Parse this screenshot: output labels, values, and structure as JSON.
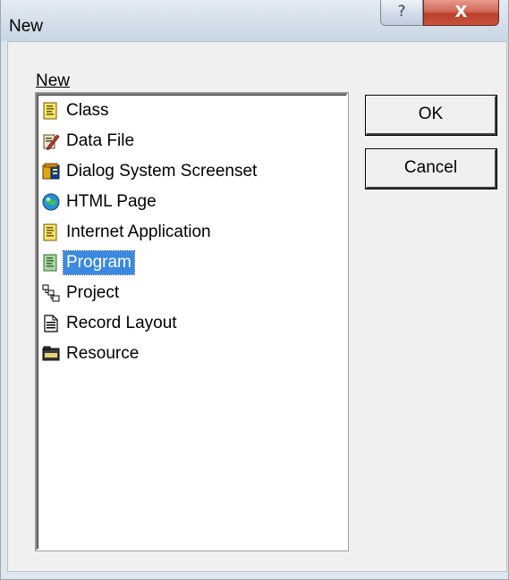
{
  "window": {
    "title": "New",
    "help_glyph": "?",
    "close_glyph": "X"
  },
  "dialog": {
    "list_label": "New",
    "ok_label": "OK",
    "cancel_label": "Cancel",
    "selected_item": "Program"
  },
  "list": {
    "items": [
      {
        "label": "Class",
        "icon": "class-document-icon"
      },
      {
        "label": "Data File",
        "icon": "data-file-pencil-icon"
      },
      {
        "label": "Dialog System Screenset",
        "icon": "dialog-system-screenset-icon"
      },
      {
        "label": "HTML Page",
        "icon": "html-page-globe-icon"
      },
      {
        "label": "Internet Application",
        "icon": "internet-application-document-icon"
      },
      {
        "label": "Program",
        "icon": "program-document-icon"
      },
      {
        "label": "Project",
        "icon": "project-tree-icon"
      },
      {
        "label": "Record Layout",
        "icon": "record-layout-document-icon"
      },
      {
        "label": "Resource",
        "icon": "resource-folder-icon"
      }
    ]
  },
  "colors": {
    "selection": "#3b89e0",
    "close_button": "#c8533c",
    "titlebar": "#d5e0eb"
  }
}
